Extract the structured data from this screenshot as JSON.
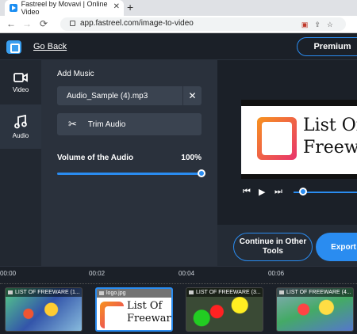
{
  "browser": {
    "tab_title": "Fastreel by Movavi | Online Video",
    "url": "app.fastreel.com/image-to-video"
  },
  "topbar": {
    "go_back": "Go Back",
    "premium": "Premium"
  },
  "sidebar": {
    "items": [
      {
        "label": "Video",
        "icon": "video-camera-icon"
      },
      {
        "label": "Audio",
        "icon": "music-note-icon"
      }
    ]
  },
  "panel": {
    "add_music_label": "Add Music",
    "file_name": "Audio_Sample (4).mp3",
    "trim_audio": "Trim Audio",
    "volume_label": "Volume of the Audio",
    "volume_value": "100%",
    "volume_fraction": 1.0
  },
  "preview": {
    "brand_line1": "List Of",
    "brand_line2": "Freeware",
    "playback_fraction": 0.15
  },
  "actions": {
    "continue_label": "Continue in Other Tools",
    "export_label": "Export"
  },
  "timeline": {
    "ticks": [
      "00:00",
      "00:02",
      "00:04",
      "00:06"
    ],
    "clips": [
      {
        "title": "LIST OF FREEWARE (1...",
        "thumb": "map1",
        "selected": false
      },
      {
        "title": "logo.jpg",
        "thumb": "logo-clip",
        "selected": true
      },
      {
        "title": "LIST OF FREEWARE (3...",
        "thumb": "map2",
        "selected": false
      },
      {
        "title": "LIST OF FREEWARE (4...",
        "thumb": "map3",
        "selected": false
      }
    ]
  },
  "colors": {
    "accent": "#2a8cf0",
    "background": "#1b2028",
    "panel": "#2a313c"
  }
}
